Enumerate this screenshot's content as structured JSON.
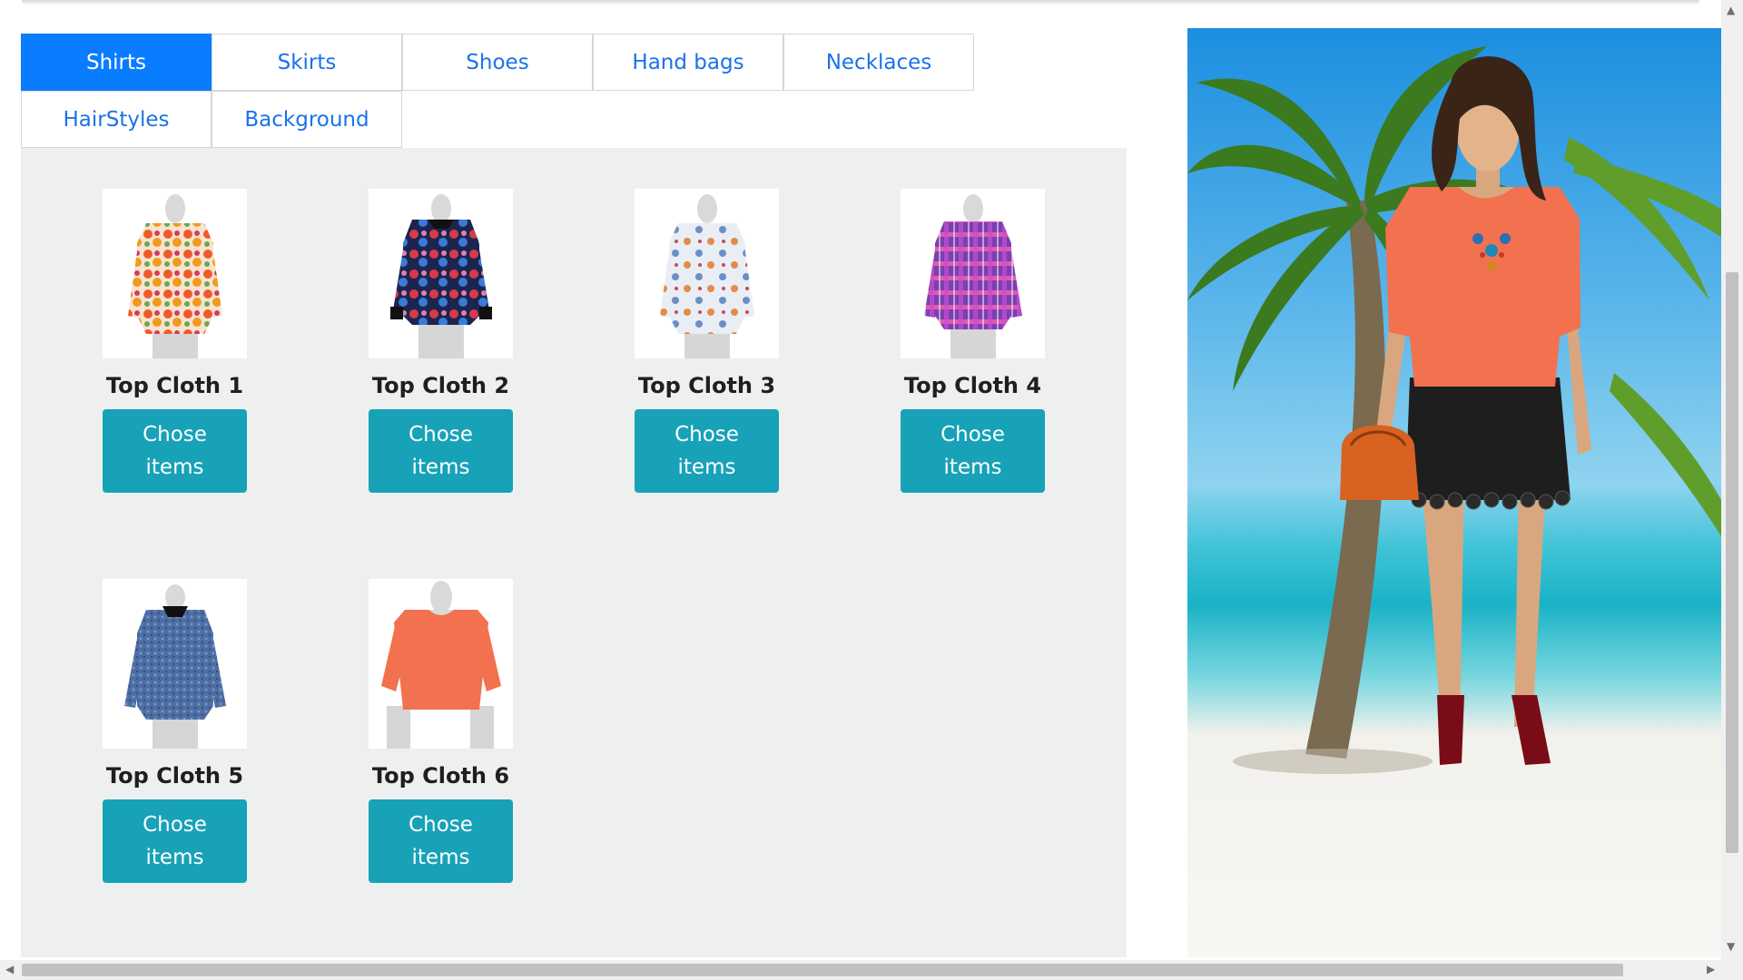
{
  "tabs": [
    {
      "label": "Shirts",
      "active": true
    },
    {
      "label": "Skirts",
      "active": false
    },
    {
      "label": "Shoes",
      "active": false
    },
    {
      "label": "Hand bags",
      "active": false
    },
    {
      "label": "Necklaces",
      "active": false
    },
    {
      "label": "HairStyles",
      "active": false
    },
    {
      "label": "Background",
      "active": false
    }
  ],
  "items": [
    {
      "title": "Top Cloth 1",
      "button": "Chose items",
      "pattern": "floral-multicolor"
    },
    {
      "title": "Top Cloth 2",
      "button": "Chose items",
      "pattern": "floral-dark"
    },
    {
      "title": "Top Cloth 3",
      "button": "Chose items",
      "pattern": "floral-light"
    },
    {
      "title": "Top Cloth 4",
      "button": "Chose items",
      "pattern": "plaid-purple-pink"
    },
    {
      "title": "Top Cloth 5",
      "button": "Chose items",
      "pattern": "denim-blue"
    },
    {
      "title": "Top Cloth 6",
      "button": "Chose items",
      "pattern": "solid-coral"
    }
  ],
  "colors": {
    "tab_active": "#0a7cff",
    "tab_text": "#1a73e8",
    "button": "#17a2b8",
    "panel_bg": "#eef0f0"
  },
  "preview": {
    "scene": "beach-with-palm-tree",
    "top_color": "#f2714f",
    "skirt_color": "#1e1e1e",
    "bag_color": "#d8621f",
    "shoes_color": "#7a0c18"
  }
}
